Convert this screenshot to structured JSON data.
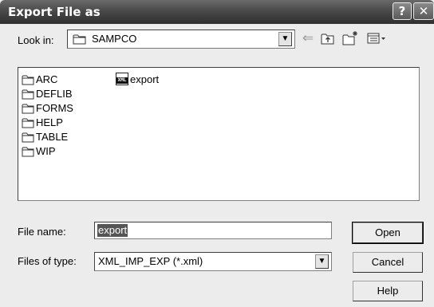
{
  "window": {
    "title": "Export File as",
    "help_glyph": "?",
    "close_glyph": "✕"
  },
  "toolbar": {
    "look_in_label": "Look in:",
    "look_in_value": "SAMPCO",
    "icons": [
      "back-arrow-icon",
      "up-one-level-icon",
      "create-new-folder-icon",
      "view-menu-icon"
    ]
  },
  "file_list": {
    "folders": [
      {
        "label": "ARC"
      },
      {
        "label": "DEFLIB"
      },
      {
        "label": "FORMS"
      },
      {
        "label": "HELP"
      },
      {
        "label": "TABLE"
      },
      {
        "label": "WIP"
      }
    ],
    "files": [
      {
        "label": "export",
        "icon_text": "XML"
      }
    ]
  },
  "form": {
    "file_name_label": "File name:",
    "file_name_value": "export",
    "files_of_type_label": "Files of type:",
    "files_of_type_value": "XML_IMP_EXP (*.xml)"
  },
  "buttons": {
    "open": "Open",
    "cancel": "Cancel",
    "help": "Help"
  },
  "colors": {
    "title_bar": "#4a4a4a",
    "dialog_face": "#ececec",
    "selection": "#555555"
  }
}
